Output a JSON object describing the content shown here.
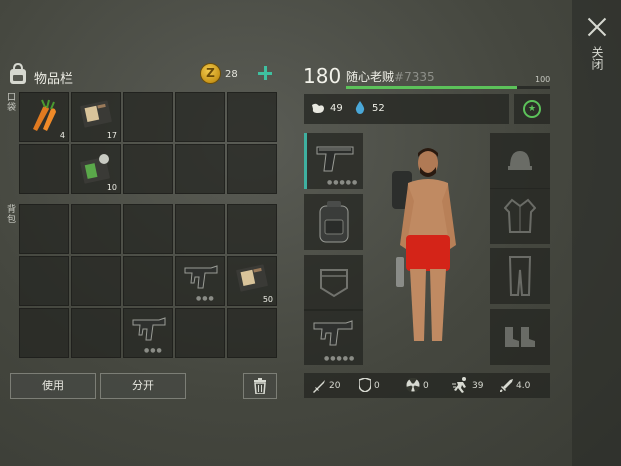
{
  "close": {
    "label": "关闭"
  },
  "inventory": {
    "title": "物品栏",
    "coins": "28",
    "pocket_label": "口袋",
    "backpack_label": "背包",
    "pocket_slots": [
      {
        "item": "carrot",
        "qty": "4"
      },
      {
        "item": "notebook",
        "qty": "17"
      },
      {
        "item": "empty",
        "qty": ""
      },
      {
        "item": "empty",
        "qty": ""
      },
      {
        "item": "empty",
        "qty": ""
      },
      {
        "item": "empty",
        "qty": ""
      },
      {
        "item": "notebook-badge",
        "qty": "10"
      },
      {
        "item": "empty",
        "qty": ""
      },
      {
        "item": "empty",
        "qty": ""
      },
      {
        "item": "empty",
        "qty": ""
      }
    ],
    "backpack_slots": [
      {
        "item": "empty",
        "qty": ""
      },
      {
        "item": "empty",
        "qty": ""
      },
      {
        "item": "empty",
        "qty": ""
      },
      {
        "item": "empty",
        "qty": ""
      },
      {
        "item": "empty",
        "qty": ""
      },
      {
        "item": "empty",
        "qty": ""
      },
      {
        "item": "empty",
        "qty": ""
      },
      {
        "item": "empty",
        "qty": ""
      },
      {
        "item": "smg",
        "qty": ""
      },
      {
        "item": "notebook",
        "qty": "50"
      },
      {
        "item": "empty",
        "qty": ""
      },
      {
        "item": "empty",
        "qty": ""
      },
      {
        "item": "smg",
        "qty": ""
      },
      {
        "item": "empty",
        "qty": ""
      },
      {
        "item": "empty",
        "qty": ""
      }
    ],
    "use_label": "使用",
    "split_label": "分开"
  },
  "character": {
    "level": "180",
    "name": "随心老贼",
    "id": "#7335",
    "xp_max": "100",
    "xp_fraction": 0.84,
    "hunger": "49",
    "thirst": "52",
    "bottom_stats": {
      "attack": "20",
      "defense": "0",
      "radiation": "0",
      "speed": "39",
      "extra": "4.0"
    }
  },
  "colors": {
    "accent": "#3fb0a0",
    "xp": "#5cc25a",
    "coin": "#e0b030"
  }
}
